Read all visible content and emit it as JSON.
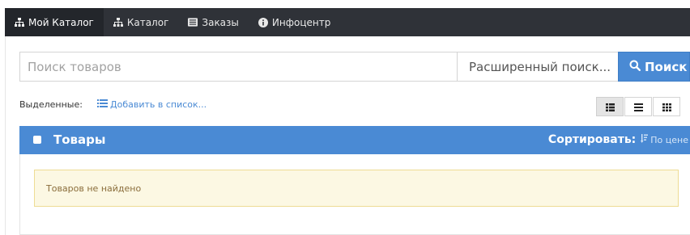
{
  "nav": {
    "items": [
      {
        "label": "Мой Каталог",
        "icon": "sitemap-icon",
        "active": true
      },
      {
        "label": "Каталог",
        "icon": "sitemap-icon",
        "active": false
      },
      {
        "label": "Заказы",
        "icon": "list-card-icon",
        "active": false
      },
      {
        "label": "Инфоцентр",
        "icon": "info-circle-icon",
        "active": false
      }
    ]
  },
  "search": {
    "placeholder": "Поиск товаров",
    "value": "",
    "advanced_label": "Расширенный поиск...",
    "button_label": "Поиск"
  },
  "selection": {
    "label": "Выделенные:",
    "add_to_list": "Добавить в список..."
  },
  "view_modes": [
    "list-detail-icon",
    "list-icon",
    "grid-icon"
  ],
  "panel": {
    "title": "Товары",
    "sort_label": "Сортировать:",
    "sort_link": "По цене",
    "empty_message": "Товаров не найдено"
  },
  "colors": {
    "navbar": "#2f3238",
    "accent": "#4a8ad4",
    "alert_bg": "#fcf8e3",
    "alert_text": "#8a6d3b"
  }
}
